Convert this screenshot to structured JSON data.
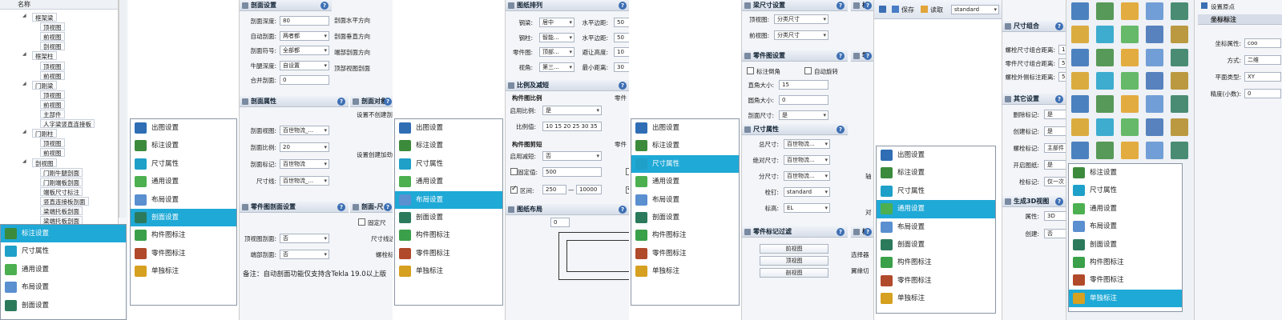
{
  "colors": {
    "accent": "#1fa9d6",
    "header": "#d6dde8",
    "border": "#a9b3c2"
  },
  "tree": {
    "col": "名称",
    "items": [
      {
        "t": "框架梁",
        "l": 2,
        "b": true
      },
      {
        "t": "顶视图",
        "l": 3,
        "b": true
      },
      {
        "t": "前视图",
        "l": 3,
        "b": true
      },
      {
        "t": "剖视图",
        "l": 3,
        "b": true
      },
      {
        "t": "框架柱",
        "l": 2,
        "b": true
      },
      {
        "t": "顶视图",
        "l": 3,
        "b": true
      },
      {
        "t": "前视图",
        "l": 3,
        "b": true
      },
      {
        "t": "门刚梁",
        "l": 2,
        "b": true
      },
      {
        "t": "顶视图",
        "l": 3,
        "b": true
      },
      {
        "t": "前视图",
        "l": 3,
        "b": true
      },
      {
        "t": "主部件",
        "l": 3,
        "b": true
      },
      {
        "t": "人字梁竖直连接板",
        "l": 3,
        "b": true
      },
      {
        "t": "门刚柱",
        "l": 2,
        "b": true
      },
      {
        "t": "顶视图",
        "l": 3,
        "b": true
      },
      {
        "t": "前视图",
        "l": 3,
        "b": true
      },
      {
        "t": "剖视图",
        "l": 2,
        "b": true
      },
      {
        "t": "门刚牛腿剖面",
        "l": 3,
        "b": true
      },
      {
        "t": "门刚端板剖面",
        "l": 3,
        "b": true
      },
      {
        "t": "端板尺寸标注",
        "l": 3,
        "b": true
      },
      {
        "t": "竖直连接板剖面",
        "l": 3,
        "b": true
      },
      {
        "t": "梁端托板剖面",
        "l": 3,
        "b": true
      },
      {
        "t": "梁端托板剖面",
        "l": 3,
        "b": true
      }
    ]
  },
  "menu1": {
    "items": [
      "标注设置",
      "尺寸属性",
      "通用设置",
      "布局设置",
      "剖面设置"
    ],
    "sel": 0
  },
  "menuMain": {
    "items": [
      "出图设置",
      "标注设置",
      "尺寸属性",
      "通用设置",
      "布局设置",
      "剖面设置",
      "构件图标注",
      "零件图标注",
      "单独标注"
    ]
  },
  "menu2sel": 5,
  "menu3sel": 4,
  "menu4sel": 2,
  "menu5sel": 3,
  "menu6": {
    "items": [
      "标注设置",
      "尺寸属性",
      "通用设置",
      "布局设置",
      "剖面设置",
      "构件图标注",
      "零件图标注",
      "单独标注"
    ],
    "sel": 7
  },
  "p1": {
    "s1": {
      "title": "剖面设置",
      "rows": [
        {
          "l": "剖面深度:",
          "v": "80",
          "dd": false
        },
        {
          "l": "自动剖面:",
          "v": "两者都",
          "dd": true
        },
        {
          "l": "剖面符号:",
          "v": "全部都",
          "dd": true
        },
        {
          "l": "牛腿深度:",
          "v": "自设置",
          "dd": true
        },
        {
          "l": "合并剖面:",
          "v": "0",
          "dd": false
        }
      ],
      "right": [
        "剖面水平方向",
        "剖面垂直方向",
        "端部剖面方向",
        "顶部视图剖面"
      ]
    },
    "s2": {
      "title": "剖面属性",
      "rows": [
        {
          "l": "剖面视图:",
          "v": "百世物流_...",
          "dd": true
        },
        {
          "l": "剖面比例:",
          "v": "20",
          "dd": true
        },
        {
          "l": "剖面标记:",
          "v": "百世物流",
          "dd": true
        },
        {
          "l": "尺寸线:",
          "v": "百世物流_...",
          "dd": true
        }
      ]
    },
    "s2b": {
      "title": "剖面对象",
      "lines": [
        "设置不创建剖",
        "设置创建加劲"
      ]
    },
    "s3": {
      "title": "零件图剖面设置",
      "rows": [
        {
          "l": "顶视图剖面:",
          "v": "否",
          "dd": true
        },
        {
          "l": "端部剖面:",
          "v": "否",
          "dd": true
        }
      ]
    },
    "s3b": {
      "title": "剖面-尺",
      "lines": [
        "固定尺",
        "尺寸线边",
        "螺栓标"
      ]
    },
    "note": "备注：自动剖面功能仅支持含Tekla 19.0以上版"
  },
  "p2": {
    "s1": {
      "title": "图纸排列",
      "rows": [
        {
          "l": "钢梁:",
          "v": "居中"
        },
        {
          "l": "钢柱:",
          "v": "智能..."
        },
        {
          "l": "零件图:",
          "v": "顶部..."
        },
        {
          "l": "视角:",
          "v": "第三..."
        }
      ],
      "right": [
        {
          "l": "水平边距:",
          "v": "50"
        },
        {
          "l": "水平边距:",
          "v": "50"
        },
        {
          "l": "避让高度:",
          "v": "10"
        },
        {
          "l": "最小距离:",
          "v": "30"
        }
      ]
    },
    "s2": {
      "title": "比例及减短",
      "sub1": "构件图比例",
      "r1": {
        "l": "启用比例:",
        "v": "是"
      },
      "r2": {
        "l": "比例值:",
        "v": "10 15 20 25 30 35"
      },
      "side1": "零件",
      "sub2": "构件图剪短",
      "r3": {
        "l": "启用减短:",
        "v": "否"
      },
      "r4": {
        "l": "固定值:",
        "v": "500"
      },
      "r5": {
        "l": "区间:",
        "a": "250",
        "sep": "—",
        "b": "10000"
      },
      "side2": "零件"
    },
    "s3": {
      "title": "图纸布局",
      "val": "0"
    }
  },
  "p3": {
    "s1": {
      "title": "梁尺寸设置",
      "rows": [
        {
          "l": "顶视图:",
          "v": "分类尺寸"
        },
        {
          "l": "前视图:",
          "v": "分类尺寸"
        }
      ],
      "side": "柱"
    },
    "s2": {
      "title": "零件图设置",
      "c1": "标注倒角",
      "c2": "自动旋转",
      "rows": [
        {
          "l": "直角大小:",
          "v": "15"
        },
        {
          "l": "圆角大小:",
          "v": "0"
        },
        {
          "l": "剖面尺寸:",
          "v": "是"
        }
      ],
      "side": "零"
    },
    "s3": {
      "title": "尺寸属性",
      "rows": [
        {
          "l": "总尺寸:",
          "v": "百世物流..."
        },
        {
          "l": "绝对尺寸:",
          "v": "百世物流..."
        },
        {
          "l": "分尺寸:",
          "v": "百世物流..."
        },
        {
          "l": "栓钉:",
          "v": "standard"
        },
        {
          "l": "标高:",
          "v": "EL"
        }
      ],
      "side": [
        "轴",
        "对"
      ]
    },
    "s4": {
      "title": "零件标记过滤",
      "btns": [
        "前视图",
        "顶视图",
        "剖视图"
      ]
    },
    "s4b": {
      "title": "标",
      "lines": [
        "选择器",
        "翼缘切"
      ]
    }
  },
  "p4": {
    "toolbar": {
      "save": "保存",
      "read": "读取",
      "combo": "standard"
    }
  },
  "p5": {
    "s1": {
      "title": "尺寸组合",
      "rows": [
        {
          "l": "螺栓尺寸组合距离:",
          "v": "10"
        },
        {
          "l": "零件尺寸组合距离:",
          "v": "50"
        },
        {
          "l": "螺栓外侧标注距离:",
          "v": "50"
        }
      ]
    },
    "s2": {
      "title": "其它设置",
      "rows": [
        {
          "l": "删除标记:",
          "v": "是"
        },
        {
          "l": "创建标记:",
          "v": "是"
        },
        {
          "l": "螺栓标记:",
          "v": "主部件"
        },
        {
          "l": "开启图纸:",
          "v": "是"
        },
        {
          "l": "栓标记:",
          "v": "仅一次"
        }
      ]
    },
    "s3": {
      "title": "生成3D视图",
      "rows": [
        {
          "l": "属性:",
          "v": "3D"
        },
        {
          "l": "创建:",
          "v": "否"
        }
      ]
    }
  },
  "p7": {
    "top": "设置原点",
    "title": "坐标标注",
    "rows": [
      {
        "l": "坐标属性:",
        "v": "coo"
      },
      {
        "l": "方式:",
        "v": "二维"
      },
      {
        "l": "平面类型:",
        "v": "XY"
      },
      {
        "l": "精度(小数):",
        "v": "0"
      }
    ]
  }
}
